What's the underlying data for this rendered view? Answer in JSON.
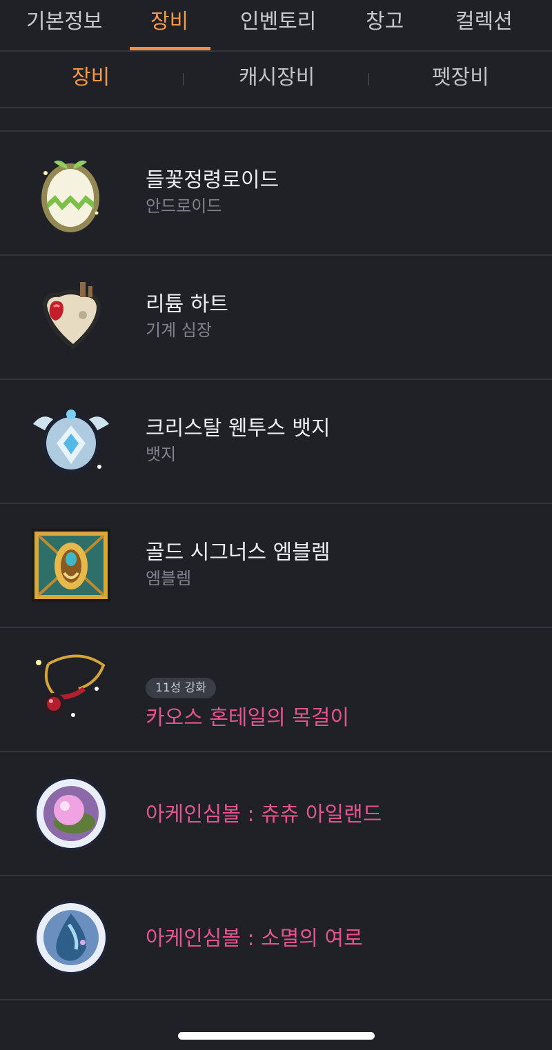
{
  "tabs": [
    {
      "label": "기본정보",
      "active": false
    },
    {
      "label": "장비",
      "active": true
    },
    {
      "label": "인벤토리",
      "active": false
    },
    {
      "label": "창고",
      "active": false
    },
    {
      "label": "컬렉션",
      "active": false
    }
  ],
  "subtabs": [
    {
      "label": "장비",
      "active": true
    },
    {
      "label": "캐시장비",
      "active": false
    },
    {
      "label": "펫장비",
      "active": false
    }
  ],
  "items": [
    {
      "name": "들꽃정령로이드",
      "type": "안드로이드",
      "icon": "android-egg-icon"
    },
    {
      "name": "리튬 하트",
      "type": "기계 심장",
      "icon": "mechanical-heart-icon"
    },
    {
      "name": "크리스탈 웬투스 뱃지",
      "type": "뱃지",
      "icon": "crystal-badge-icon"
    },
    {
      "name": "골드 시그너스 엠블렘",
      "type": "엠블렘",
      "icon": "gold-emblem-icon"
    },
    {
      "name": "카오스 혼테일의 목걸이",
      "badge": "11성 강화",
      "icon": "necklace-icon"
    },
    {
      "name": "아케인심볼 : 츄츄 아일랜드",
      "icon": "arcane-symbol-chuchu-icon"
    },
    {
      "name": "아케인심볼 : 소멸의 여로",
      "icon": "arcane-symbol-vanishing-icon"
    }
  ],
  "colors": {
    "background": "#202127",
    "accent": "#f39a4a",
    "pink_item": "#e4558f"
  }
}
